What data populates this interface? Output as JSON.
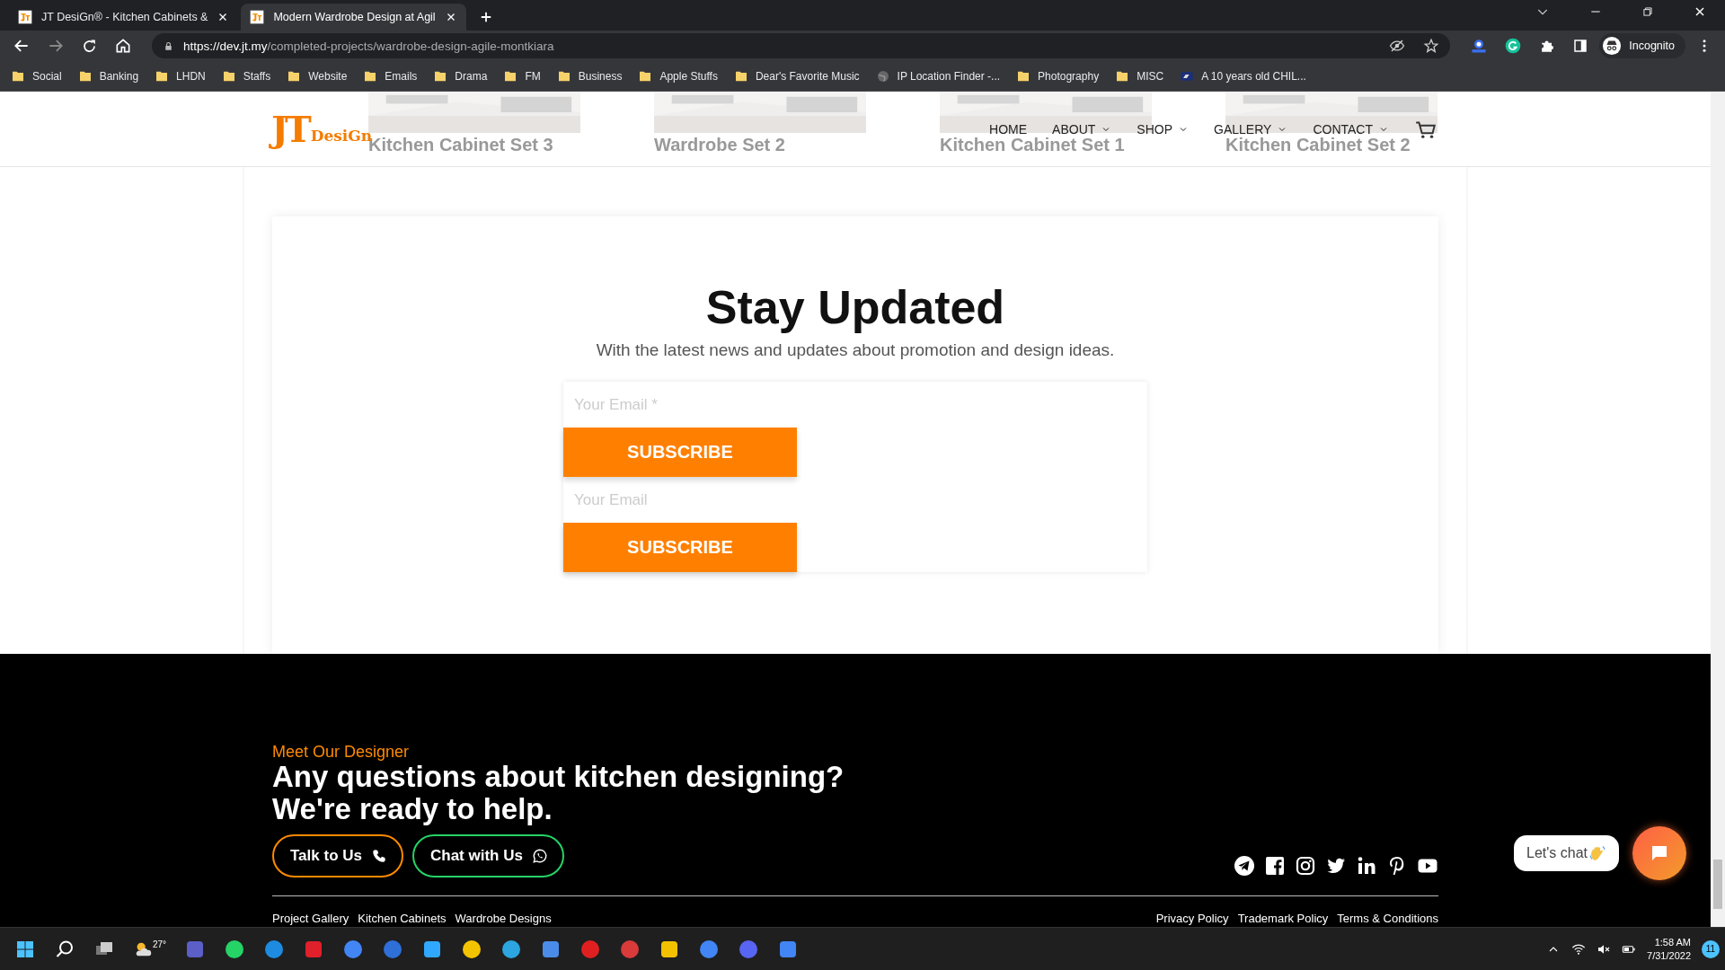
{
  "browser": {
    "tabs": [
      {
        "title": "JT DesiGn® - Kitchen Cabinets &",
        "selected": false
      },
      {
        "title": "Modern Wardrobe Design at Agil",
        "selected": true
      }
    ],
    "url": {
      "host": "https://dev.jt.my",
      "path": "/completed-projects/wardrobe-design-agile-montkiara"
    },
    "profile": "Incognito",
    "bookmarks": [
      {
        "label": "Social",
        "kind": "folder"
      },
      {
        "label": "Banking",
        "kind": "folder"
      },
      {
        "label": "LHDN",
        "kind": "folder"
      },
      {
        "label": "Staffs",
        "kind": "folder"
      },
      {
        "label": "Website",
        "kind": "folder"
      },
      {
        "label": "Emails",
        "kind": "folder"
      },
      {
        "label": "Drama",
        "kind": "folder"
      },
      {
        "label": "FM",
        "kind": "folder"
      },
      {
        "label": "Business",
        "kind": "folder"
      },
      {
        "label": "Apple Stuffs",
        "kind": "folder"
      },
      {
        "label": "Dear's Favorite Music",
        "kind": "folder"
      },
      {
        "label": "IP Location Finder -...",
        "kind": "globe"
      },
      {
        "label": "Photography",
        "kind": "folder"
      },
      {
        "label": "MISC",
        "kind": "folder"
      },
      {
        "label": "A 10 years old CHIL...",
        "kind": "site"
      }
    ]
  },
  "header": {
    "logo": {
      "mark": "JT",
      "text": "DesiGn"
    },
    "nav": [
      {
        "label": "HOME",
        "dropdown": false
      },
      {
        "label": "ABOUT",
        "dropdown": true
      },
      {
        "label": "SHOP",
        "dropdown": true
      },
      {
        "label": "GALLERY",
        "dropdown": true
      },
      {
        "label": "CONTACT",
        "dropdown": true
      }
    ],
    "behind": [
      {
        "caption": "Kitchen Cabinet Set 3"
      },
      {
        "caption": "Wardrobe Set 2"
      },
      {
        "caption": "Kitchen Cabinet Set 1"
      },
      {
        "caption": "Kitchen Cabinet Set 2"
      }
    ]
  },
  "newsletter": {
    "title": "Stay Updated",
    "subtitle": "With the latest news and updates about promotion and design ideas.",
    "forms": [
      {
        "placeholder": "Your Email *",
        "button": "SUBSCRIBE"
      },
      {
        "placeholder": "Your Email",
        "button": "SUBSCRIBE"
      }
    ]
  },
  "footer": {
    "eyebrow": "Meet Our Designer",
    "heading": [
      "Any questions about kitchen designing?",
      "We're ready to help."
    ],
    "buttons": [
      {
        "label": "Talk to Us",
        "kind": "phone"
      },
      {
        "label": "Chat with Us",
        "kind": "whatsapp"
      }
    ],
    "links_left": [
      "Project Gallery",
      "Kitchen Cabinets",
      "Wardrobe Designs"
    ],
    "links_right": [
      "Privacy Policy",
      "Trademark Policy",
      "Terms & Conditions"
    ]
  },
  "chat": {
    "label": "Let's chat"
  },
  "taskbar": {
    "weather": "27°",
    "time": "1:58 AM",
    "date": "7/31/2022",
    "badge": "11"
  }
}
